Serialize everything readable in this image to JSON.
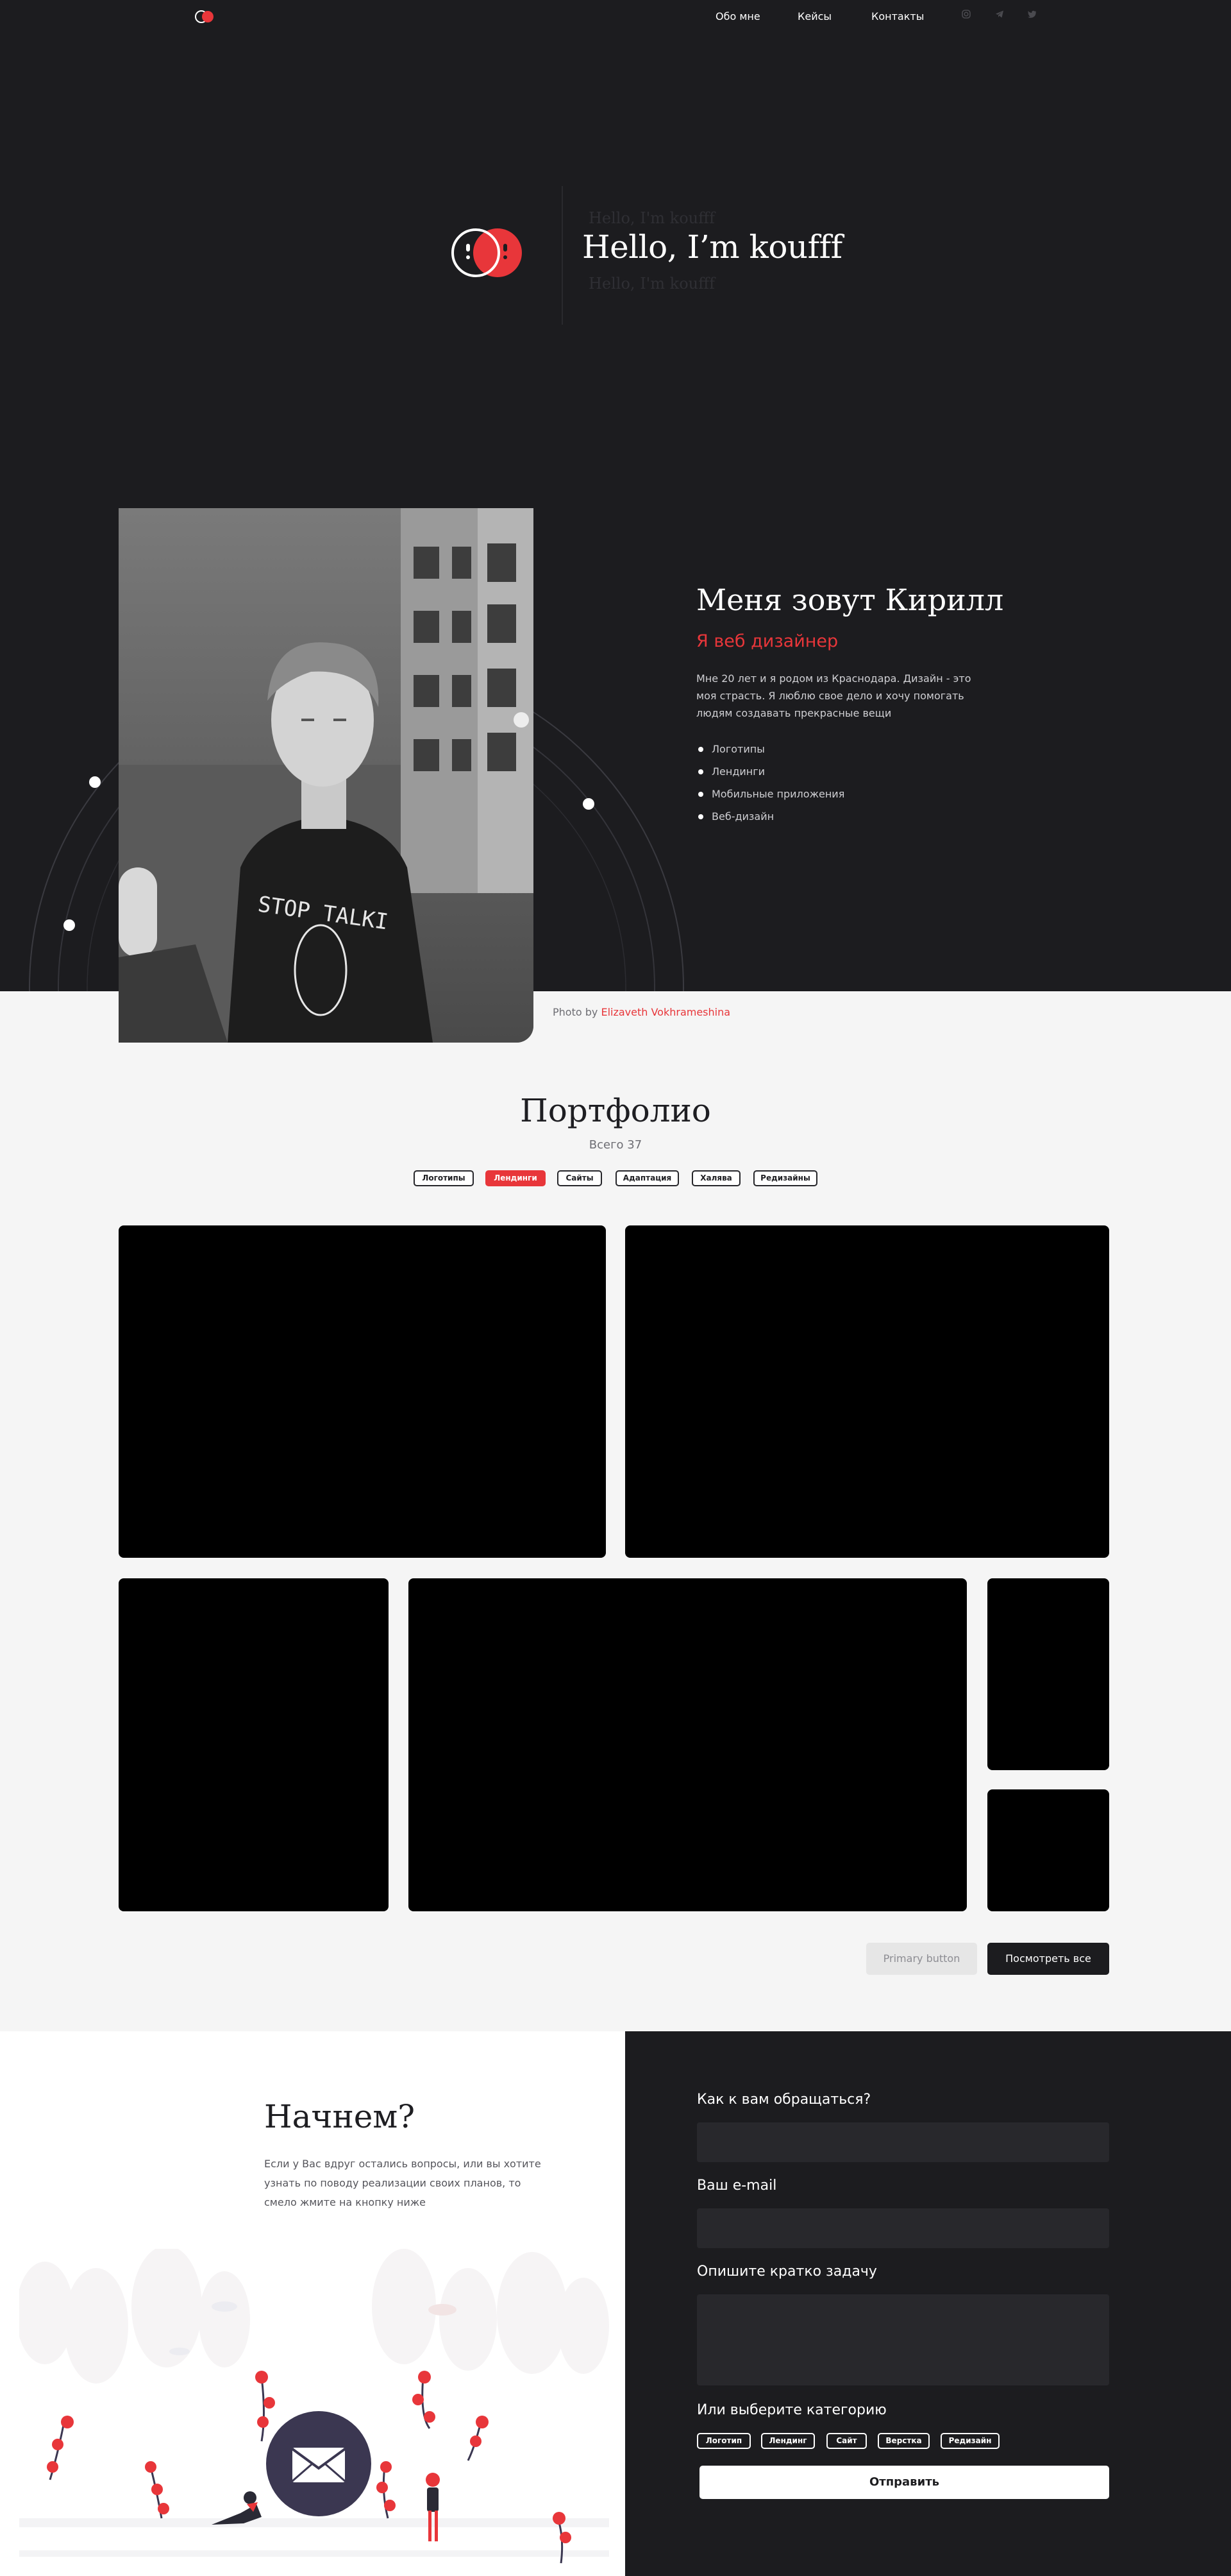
{
  "nav": {
    "links": [
      "Обо мне",
      "Кейсы",
      "Контакты"
    ],
    "social_icons": [
      "instagram-icon",
      "telegram-icon",
      "twitter-icon"
    ]
  },
  "hero": {
    "ghost_top": "Hello, I'm koufff",
    "title": "Hello, I’m koufff",
    "ghost_bottom": "Hello, I'm koufff"
  },
  "about": {
    "name": "Меня зовут Кирилл",
    "role": "Я веб дизайнер",
    "description": "Мне 20 лет и я родом из Краснодара. Дизайн - это моя страсть. Я люблю свое дело и хочу помогать людям создавать прекрасные вещи",
    "skills": [
      "Логотипы",
      "Лендинги",
      "Мобильные приложения",
      "Веб-дизайн"
    ],
    "photo_credit_prefix": "Photo by",
    "photo_credit_author": "Elizaveth Vokhrameshina",
    "photo_shirt_text": "STOP TALKI"
  },
  "portfolio": {
    "title": "Портфолио",
    "count": "Всего 37",
    "filters": [
      "Логотипы",
      "Лендинги",
      "Сайты",
      "Адаптация",
      "Халява",
      "Редизайны"
    ],
    "active_filter": "Лендинги",
    "primary_button": "Primary button",
    "view_all_button": "Посмотреть все"
  },
  "contact": {
    "title": "Начнем?",
    "description": "Если у Вас вдруг остались вопросы, или вы хотите узнать  по поводу реализации своих планов, то смело жмите на кнопку ниже",
    "form": {
      "name_label": "Как к вам обращаться?",
      "email_label": "Ваш e-mail",
      "task_label": "Опишите кратко задачу",
      "category_label": "Или выберите категорию",
      "categories": [
        "Логотип",
        "Лендинг",
        "Сайт",
        "Верстка",
        "Редизайн"
      ],
      "submit": "Отправить"
    }
  },
  "colors": {
    "accent": "#e8363a",
    "dark": "#1c1c1f",
    "light": "#f5f5f5"
  }
}
